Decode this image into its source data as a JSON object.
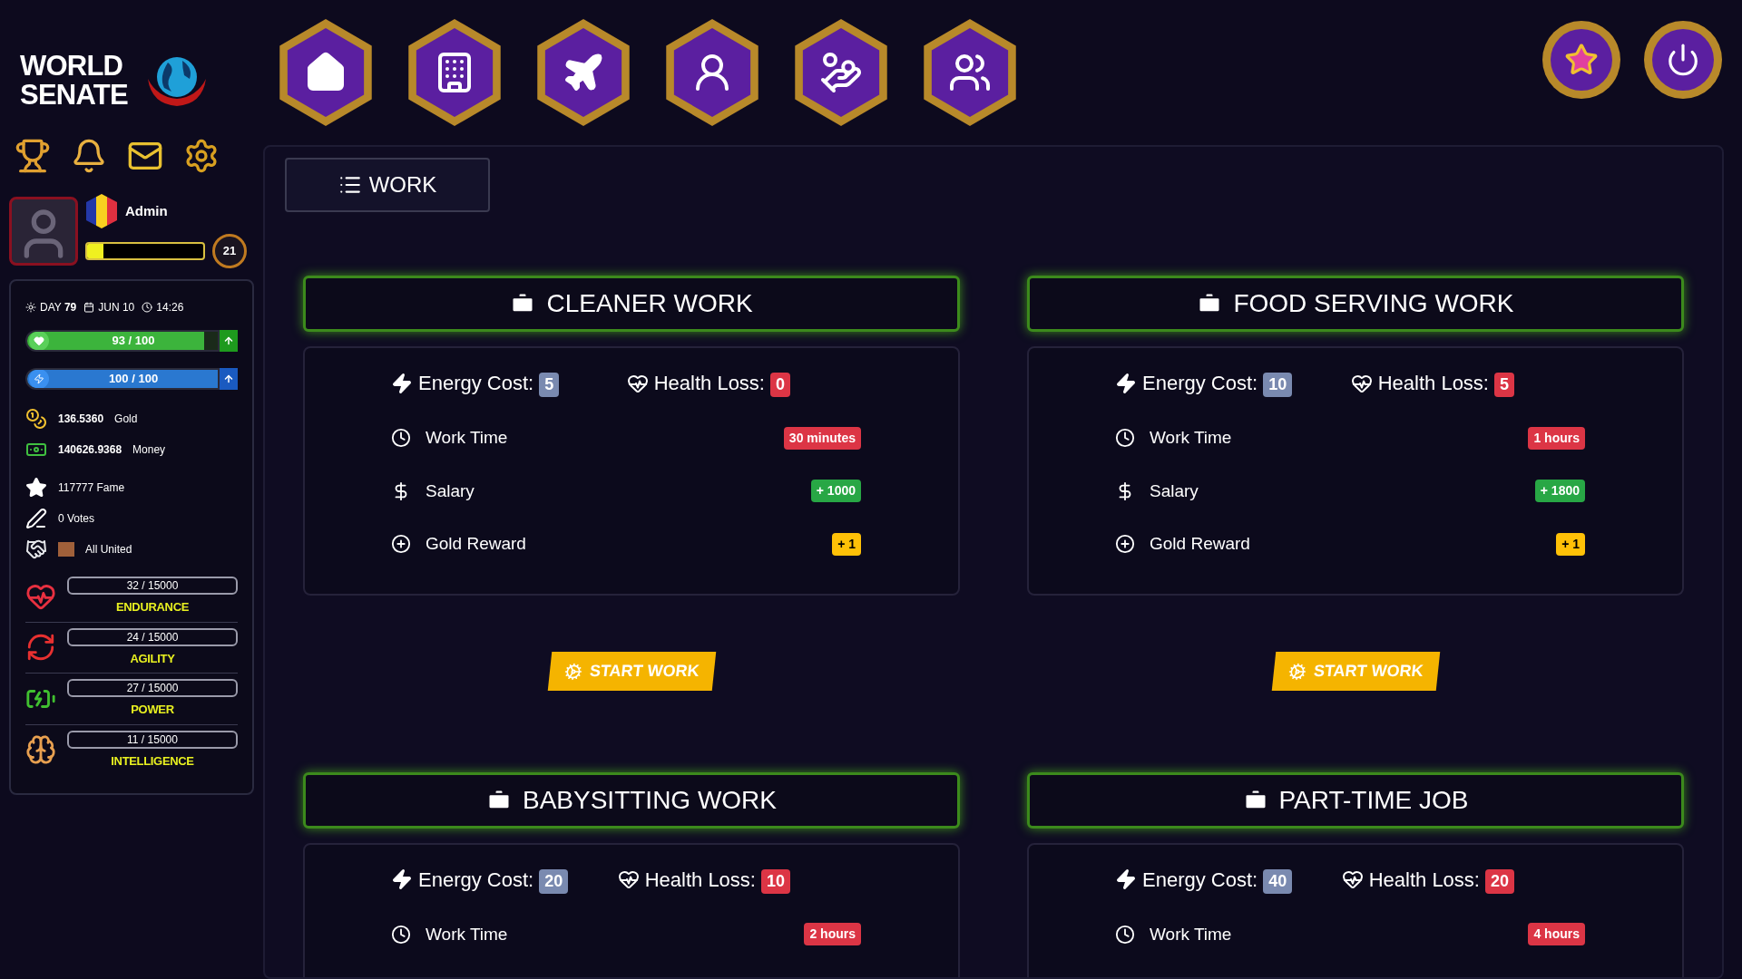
{
  "brand": {
    "line1": "WORLD",
    "line2": "SENATE"
  },
  "nav": [
    {
      "kind": "home"
    },
    {
      "kind": "building"
    },
    {
      "kind": "plane"
    },
    {
      "kind": "astronaut"
    },
    {
      "kind": "salary"
    },
    {
      "kind": "users"
    }
  ],
  "corner": [
    {
      "kind": "medal"
    },
    {
      "kind": "power"
    }
  ],
  "shortcuts": [
    {
      "kind": "trophy"
    },
    {
      "kind": "bell"
    },
    {
      "kind": "mail"
    },
    {
      "kind": "gear"
    }
  ],
  "profile": {
    "name": "Admin",
    "level": 0.14,
    "rank": "21"
  },
  "date": {
    "day": "DAY **79**",
    "date": "JUN 10",
    "time": "14:26"
  },
  "bars": [
    {
      "kind": "health",
      "reading": "93 / 100",
      "level": 0.93
    },
    {
      "kind": "energy",
      "reading": "100 / 100",
      "level": 1
    }
  ],
  "stats": [
    {
      "kind": "gold",
      "value": "136.5360",
      "label": "Gold"
    },
    {
      "kind": "money",
      "value": "140626.9368",
      "label": "Money"
    },
    {
      "kind": "fame",
      "value": "117777 Fame"
    },
    {
      "kind": "votes",
      "value": "0 Votes"
    },
    {
      "kind": "party",
      "value": "All United"
    }
  ],
  "attributes": [
    {
      "kind": "endurance",
      "reading": "32 / 15000",
      "label": "ENDURANCE"
    },
    {
      "kind": "agility",
      "reading": "24 / 15000",
      "label": "AGILITY"
    },
    {
      "kind": "power",
      "reading": "27 / 15000",
      "label": "POWER"
    },
    {
      "kind": "intelligence",
      "reading": "11 / 15000",
      "label": "INTELLIGENCE"
    }
  ],
  "tab": {
    "label": "WORK"
  },
  "jobs": [
    {
      "title": "CLEANER WORK",
      "energy_label": "Energy Cost:",
      "energy": "5",
      "health_label": "Health Loss:",
      "health": "0",
      "rows": [
        {
          "kind": "time",
          "label": "Work Time",
          "value": "30 minutes"
        },
        {
          "kind": "salary",
          "label": "Salary",
          "value": "+ 1000"
        },
        {
          "kind": "gold",
          "label": "Gold Reward",
          "value": "+ 1"
        }
      ],
      "button": "START WORK"
    },
    {
      "title": "FOOD SERVING WORK",
      "energy_label": "Energy Cost:",
      "energy": "10",
      "health_label": "Health Loss:",
      "health": "5",
      "rows": [
        {
          "kind": "time",
          "label": "Work Time",
          "value": "1 hours"
        },
        {
          "kind": "salary",
          "label": "Salary",
          "value": "+ 1800"
        },
        {
          "kind": "gold",
          "label": "Gold Reward",
          "value": "+ 1"
        }
      ],
      "button": "START WORK"
    },
    {
      "title": "BABYSITTING WORK",
      "energy_label": "Energy Cost:",
      "energy": "20",
      "health_label": "Health Loss:",
      "health": "10",
      "rows": [
        {
          "kind": "time",
          "label": "Work Time",
          "value": "2 hours"
        }
      ]
    },
    {
      "title": "PART-TIME JOB",
      "energy_label": "Energy Cost:",
      "energy": "40",
      "health_label": "Health Loss:",
      "health": "20",
      "rows": [
        {
          "kind": "time",
          "label": "Work Time",
          "value": "4 hours"
        }
      ]
    }
  ]
}
